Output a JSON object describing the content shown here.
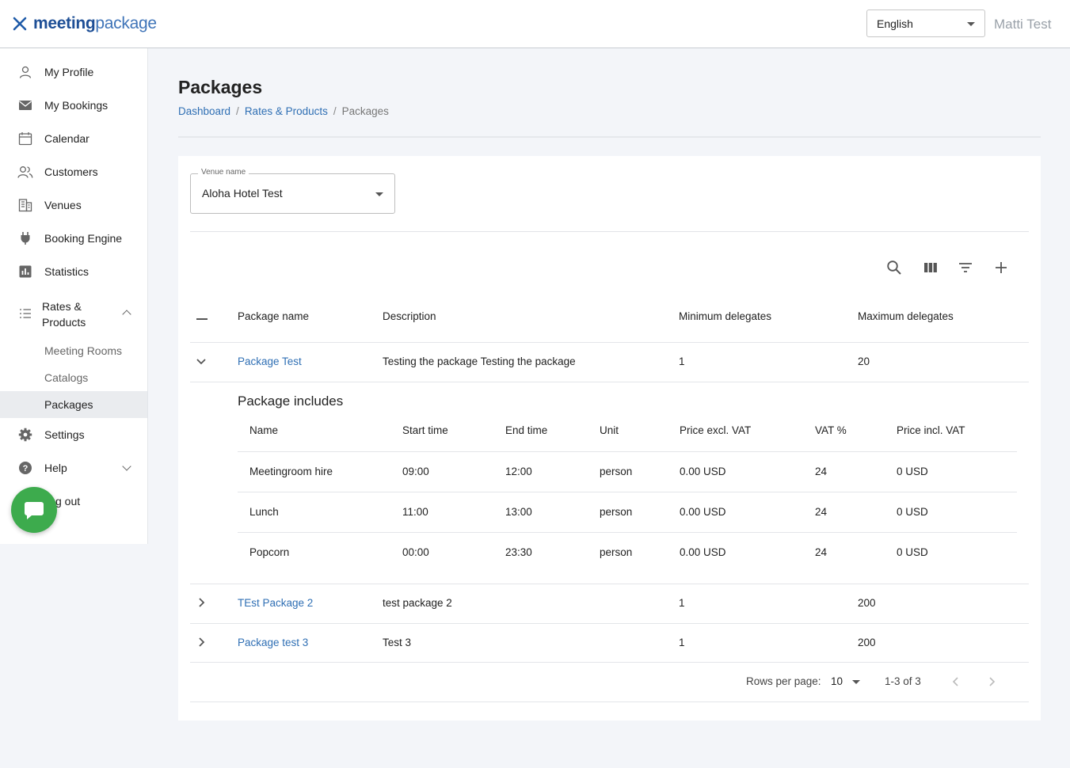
{
  "header": {
    "logo_bold": "meeting",
    "logo_light": "package",
    "language": "English",
    "user_name": "Matti Test"
  },
  "sidebar": {
    "items": [
      {
        "label": "My Profile",
        "icon": "person-icon"
      },
      {
        "label": "My Bookings",
        "icon": "mail-icon"
      },
      {
        "label": "Calendar",
        "icon": "calendar-icon"
      },
      {
        "label": "Customers",
        "icon": "people-icon"
      },
      {
        "label": "Venues",
        "icon": "building-icon"
      },
      {
        "label": "Booking Engine",
        "icon": "plug-icon"
      },
      {
        "label": "Statistics",
        "icon": "bar-chart-icon"
      },
      {
        "label": "Rates &\nProducts",
        "icon": "list-icon"
      },
      {
        "label": "Settings",
        "icon": "gear-icon"
      },
      {
        "label": "Help",
        "icon": "help-icon"
      },
      {
        "label": "Log out",
        "icon": "logout-icon"
      }
    ],
    "rates_label_line1": "Rates &",
    "rates_label_line2": "Products",
    "sub_items": [
      "Meeting Rooms",
      "Catalogs",
      "Packages"
    ],
    "logout_visible": "g out"
  },
  "page": {
    "title": "Packages",
    "breadcrumb": [
      "Dashboard",
      "Rates & Products",
      "Packages"
    ]
  },
  "venue": {
    "legend": "Venue name",
    "value": "Aloha Hotel Test"
  },
  "table": {
    "headers": [
      "Package name",
      "Description",
      "Minimum delegates",
      "Maximum delegates"
    ],
    "rows": [
      {
        "name": "Package Test",
        "description": "Testing the package Testing the package",
        "min": "1",
        "max": "20",
        "expanded": true
      },
      {
        "name": "TEst Package 2",
        "description": "test package 2",
        "min": "1",
        "max": "200",
        "expanded": false
      },
      {
        "name": "Package test 3",
        "description": "Test 3",
        "min": "1",
        "max": "200",
        "expanded": false
      }
    ]
  },
  "includes": {
    "title": "Package includes",
    "headers": [
      "Name",
      "Start time",
      "End time",
      "Unit",
      "Price excl. VAT",
      "VAT %",
      "Price incl. VAT"
    ],
    "rows": [
      [
        "Meetingroom hire",
        "09:00",
        "12:00",
        "person",
        "0.00 USD",
        "24",
        "0 USD"
      ],
      [
        "Lunch",
        "11:00",
        "13:00",
        "person",
        "0.00 USD",
        "24",
        "0 USD"
      ],
      [
        "Popcorn",
        "00:00",
        "23:30",
        "person",
        "0.00 USD",
        "24",
        "0 USD"
      ]
    ]
  },
  "pagination": {
    "rows_per_page_label": "Rows per page:",
    "rows_per_page": "10",
    "range": "1-3 of 3"
  },
  "colors": {
    "accent": "#2f6fb4",
    "chat": "#3dab4d",
    "background": "#f3f5f9"
  }
}
